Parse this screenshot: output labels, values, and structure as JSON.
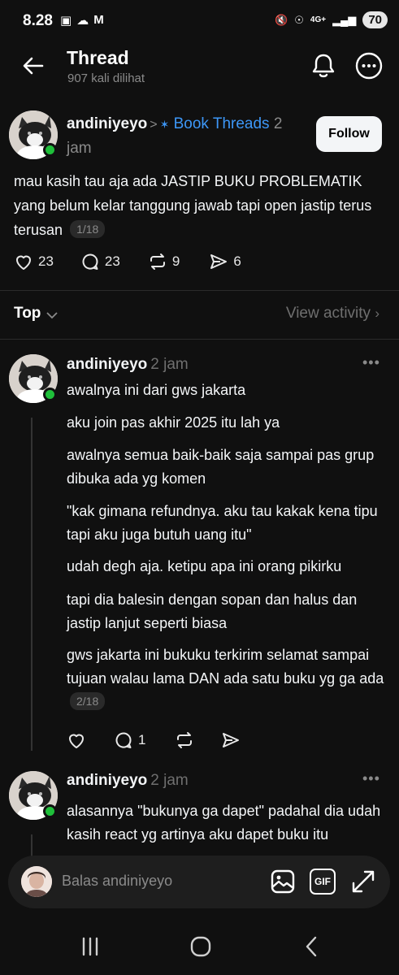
{
  "statusbar": {
    "time": "8.28",
    "left_icons": [
      "gallery-icon",
      "cloud-icon",
      "gmail-icon"
    ],
    "right_icons": [
      "mute-icon",
      "hotspot-icon",
      "signal-4g-icon"
    ],
    "network": "4G+",
    "battery": "70"
  },
  "header": {
    "title": "Thread",
    "views": "907 kali dilihat",
    "icons": [
      "back-arrow-icon",
      "bell-icon",
      "more-icon"
    ]
  },
  "main_post": {
    "username": "andiniyeyo",
    "community": "Book Threads",
    "time_part1": "2",
    "time_part2": "jam",
    "follow_label": "Follow",
    "text": "mau kasih tau aja ada JASTIP BUKU PROBLEMATIK yang belum kelar tanggung jawab tapi open jastip terus terusan",
    "pager": "1/18",
    "likes": "23",
    "replies": "23",
    "reposts": "9",
    "shares": "6"
  },
  "sort": {
    "label": "Top",
    "view_activity": "View activity"
  },
  "reply1": {
    "username": "andiniyeyo",
    "time": "2 jam",
    "paragraphs": [
      "awalnya ini dari gws jakarta",
      "aku join pas akhir 2025 itu lah ya",
      "awalnya semua baik-baik saja sampai pas grup dibuka ada yg komen",
      "\"kak gimana refundnya. aku tau kakak kena tipu tapi aku juga butuh uang itu\"",
      "udah degh aja. ketipu apa ini orang pikirku",
      "tapi dia balesin dengan sopan dan halus dan jastip lanjut seperti biasa",
      "gws jakarta ini bukuku terkirim selamat sampai tujuan walau lama DAN ada satu buku yg ga ada"
    ],
    "pager": "2/18",
    "replies": "1"
  },
  "reply2": {
    "username": "andiniyeyo",
    "time": "2 jam",
    "text": "alasannya \"bukunya ga dapet\" padahal dia udah kasih react yg artinya aku dapet buku itu"
  },
  "replybar": {
    "placeholder": "Balas andiniyeyo",
    "gif_label": "GIF",
    "icons": [
      "image-icon",
      "gif-icon",
      "expand-icon"
    ]
  },
  "navbar": {
    "icons": [
      "recent-apps-icon",
      "home-icon",
      "back-icon"
    ]
  },
  "colors": {
    "background": "#101010",
    "accent": "#3d97f7",
    "online": "#1fbf3a"
  }
}
